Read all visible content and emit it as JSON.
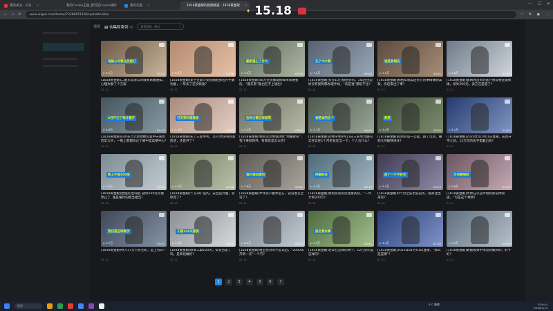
{
  "browser": {
    "tabs": [
      {
        "label": "我的关注 - 头条",
        "color": "#e53935"
      },
      {
        "label": "我的Cookie正版_我可是Cookie图片",
        "color": "#1e88e5"
      },
      {
        "label": "我的页面",
        "color": "#1e88e5"
      },
      {
        "label": "1818黄金眼的视频频道 · 1818黄金眼",
        "color": "#43a047",
        "active": true
      }
    ],
    "url": "www.ixigua.com/home/73386051180/upload/video",
    "overlay_number": "15.18"
  },
  "toolbar": {
    "tab_label": "视频",
    "series_label": "合集和系列",
    "series_count": "26",
    "search_placeholder": "搜索视频、粉丝"
  },
  "videos": [
    {
      "caption": "电脑公司营业员被打",
      "plays": "▷ 5.1万",
      "duration": "03:22",
      "title": "[1818黄金眼]二胎东北哥公司收到离婚通知，心理失衡了个方案",
      "date": "01-11",
      "c1": "#6e5a48",
      "c2": "#c9b59a"
    },
    {
      "caption": "",
      "plays": "▷ 8.5万",
      "duration": "02:46",
      "title": "[1818黄金眼]女子在职少女吃胸腔部位开手脉功能，一年多了还没恢复?",
      "date": "01-11",
      "c1": "#b38a6f",
      "c2": "#e6c2a8"
    },
    {
      "caption": "搬家遇上了什么",
      "plays": "▷ 3.2万",
      "duration": "04:16",
      "title": "[1818黄金眼]48万买房搬电梯每项目难看房，“搬东家”搬出红不上墙出?",
      "date": "01-11",
      "c1": "#5a6a58",
      "c2": "#b0b7a5"
    },
    {
      "caption": "交了中介费",
      "plays": "▷ 7.2万",
      "duration": "05:25",
      "title": "[1818黄金眼]多花10万想想买的，1年后也说好没有接到都办理手续，“房是谁”都说不出?",
      "date": "01-11",
      "c1": "#556070",
      "c2": "#9aa8b5"
    },
    {
      "caption": "谁是背锅员",
      "plays": "▷ 1.2万",
      "duration": "04:21",
      "title": "[1818黄金眼]网络车转卖后买方的事情做到卖家，房后来出了事?",
      "date": "01-11",
      "c1": "#5b4a3e",
      "c2": "#a68e78"
    },
    {
      "caption": "",
      "plays": "▷ 5.8万",
      "duration": "02:15",
      "title": "[1818黄金眼]鲁网领员买的客户协议物还需修摊，损失500元，卖方还是赔了?",
      "date": "01-11",
      "c1": "#6d7a88",
      "c2": "#d0d6dc"
    },
    {
      "caption": "2月开元了钱才建开",
      "plays": "▷ 4.6万",
      "duration": "04:14",
      "title": "[1818黄金眼]440多万元新建楼房里中天离原因实大声，一晚上家都会过了被中度高楼中心?",
      "date": "01-11",
      "c1": "#455560",
      "c2": "#8a9aa3"
    },
    {
      "caption": "已买到衣服能退",
      "plays": "▷ 5.4万",
      "duration": "03:57",
      "title": "[1818黄金眼]买了三套手机、10小时没带回家店店，还是开了?",
      "date": "01-11",
      "c1": "#a98a7c",
      "c2": "#e4cfc4"
    },
    {
      "caption": "这样主管这样被骂",
      "plays": "▷ 3.2万",
      "duration": "03:04",
      "title": "[1818黄金眼]物资流流地毯转给“地嘴教育”，有什事得到开，有朋友是怎么回?",
      "date": "01-11",
      "c1": "#6a6f63",
      "c2": "#b9baa8"
    },
    {
      "caption": "谁是谁的这个",
      "plays": "▷ 2.7万",
      "duration": "04:40",
      "title": "[1818黄金眼]药物学生9月13日三名生为期间实在实在1个月老板应当一下，个人为什么?",
      "date": "01-11",
      "c1": "#4d5a4f",
      "c2": "#9aa697"
    },
    {
      "caption": "那是",
      "plays": "▷ 3.4万",
      "duration": "03:39",
      "title": "[1818黄金眼]四新有些一公里，跑了以后，撞到大的推铁块冰?",
      "date": "01-11",
      "c1": "#3d4c3a",
      "c2": "#7d8c6e"
    },
    {
      "caption": "",
      "plays": "▷ 5.1万",
      "duration": "01:20",
      "title": "[1818黄金眼]2020年01月01日直播，在新开学之前，12万元的房子电脑出去?",
      "date": "01-11",
      "c1": "#253b6e",
      "c2": "#8196c2"
    },
    {
      "caption": "晚上不准500米",
      "plays": "▷ 2.5万",
      "duration": "03:44",
      "title": "[1818黄金眼]出租房出问题, 疑似500元可能停止了, 谁是谁付的相当相当?",
      "date": "01-11",
      "c1": "#7c8a94",
      "c2": "#c3ccd2"
    },
    {
      "caption": "",
      "plays": "▷ 4.8万",
      "duration": "02:38",
      "title": "[1818黄金眼]“门口的”是的，安全是外面，装修完了?",
      "date": "01-11",
      "c1": "#6f7b64",
      "c2": "#bcc0a8"
    },
    {
      "caption": "谁付谁知道吗",
      "plays": "▷ 3.9万",
      "duration": "04:02",
      "title": "[1818黄金眼]半年房产搬水后方，说说意见之没了?",
      "date": "01-11",
      "c1": "#5e5b56",
      "c2": "#aaa49c"
    },
    {
      "caption": "挖掘机在",
      "plays": "▷ 4.1万",
      "duration": "05:13",
      "title": "[1818黄金眼]新街房房房房连接条装，“一年才到200万?",
      "date": "01-11",
      "c1": "#4f6a78",
      "c2": "#a3b7c0"
    },
    {
      "caption": "房了一千不补交",
      "plays": "▷ 2.2万",
      "duration": "03:10",
      "title": "[1818黄金眼]9个月之前也说说点，被关注出来的?",
      "date": "01-11",
      "c1": "#3f3b52",
      "c2": "#8f8aa6"
    },
    {
      "caption": "为何要强制",
      "plays": "▷ 5.6万",
      "duration": "03:09",
      "title": "[1818黄金眼]大师在乎这件电玩家说你知道，“可是这个事情?",
      "date": "01-11",
      "c1": "#6b5560",
      "c2": "#c6aab4"
    },
    {
      "caption": "我们是这种高手",
      "plays": "▷ 3.7万",
      "duration": "03:57",
      "title": "[1818黄金眼]导入37万只长毛机，是上有么?",
      "date": "01-11",
      "c1": "#3d4858",
      "c2": "#8592a5"
    },
    {
      "caption": "工期120天都卖",
      "plays": "▷ 4.3万",
      "duration": "03:05",
      "title": "[1818黄金眼]原来工期120天，安装合适了吗，是单也做好?",
      "date": "01-11",
      "c1": "#8a8f94",
      "c2": "#d6d9dc"
    },
    {
      "caption": "",
      "plays": "▷ 6.0万",
      "duration": "06:29",
      "title": "[1818黄金眼]租出也对的不是以后，“2000年开到一次”一个行?",
      "date": "01-11",
      "c1": "#76818c",
      "c2": "#c4cbd2"
    },
    {
      "caption": "报名费有事",
      "plays": "▷ 2.9万",
      "duration": "03:41",
      "title": "[1818黄金眼]老年在这样的两个，12万买的是这样的?",
      "date": "01-11",
      "c1": "#4d6b3f",
      "c2": "#a5c08e"
    },
    {
      "caption": "",
      "plays": "▷ 4.4万",
      "duration": "01:30",
      "title": "[1818黄金眼]2022年01月01日直播，“那么是是哪”?",
      "date": "01-11",
      "c1": "#2a3f78",
      "c2": "#7f93c8"
    },
    {
      "caption": "",
      "plays": "▷ 3.5万",
      "duration": "04:09",
      "title": "[1818黄金眼]数据被到手体验到做到的，好不好?",
      "date": "01-11",
      "c1": "#5f6f7d",
      "c2": "#b5c1cb"
    }
  ],
  "pagination": [
    "1",
    "2",
    "3",
    "4",
    "5",
    "6",
    "7"
  ],
  "taskbar": {
    "search": "搜索",
    "time": "3:39:44",
    "date": "2026/1/14",
    "weather": "4°C 晴朗"
  }
}
